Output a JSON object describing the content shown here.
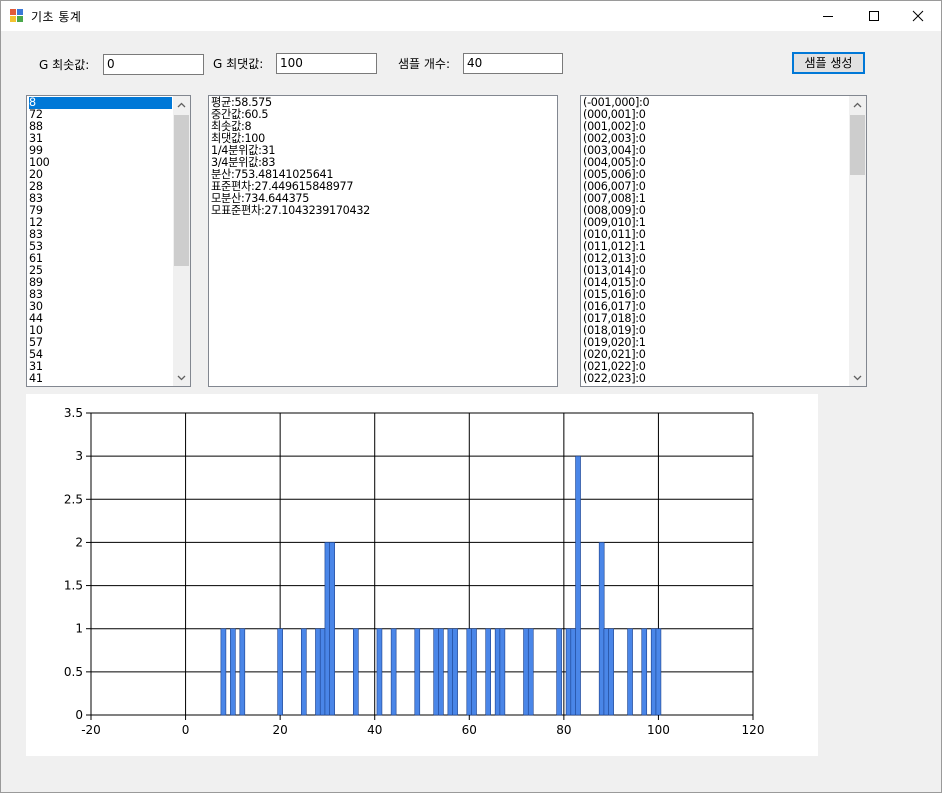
{
  "window": {
    "title": "기초 통계"
  },
  "controls": {
    "min_label": "G 최솟값:",
    "min_value": "0",
    "max_label": "G 최댓값:",
    "max_value": "100",
    "count_label": "샘플 개수:",
    "count_value": "40",
    "generate_label": "샘플 생성"
  },
  "samples": [
    "8",
    "72",
    "88",
    "31",
    "99",
    "100",
    "20",
    "28",
    "83",
    "79",
    "12",
    "83",
    "53",
    "61",
    "25",
    "89",
    "83",
    "30",
    "44",
    "10",
    "57",
    "54",
    "31",
    "41"
  ],
  "stats": [
    "평균:58.575",
    "중간값:60.5",
    "최솟값:8",
    "최댓값:100",
    "1/4분위값:31",
    "3/4분위값:83",
    "분산:753.48141025641",
    "표준편차:27.449615848977",
    "모분산:734.644375",
    "모표준편차:27.1043239170432"
  ],
  "bins": [
    "(-001,000]:0",
    "(000,001]:0",
    "(001,002]:0",
    "(002,003]:0",
    "(003,004]:0",
    "(004,005]:0",
    "(005,006]:0",
    "(006,007]:0",
    "(007,008]:1",
    "(008,009]:0",
    "(009,010]:1",
    "(010,011]:0",
    "(011,012]:1",
    "(012,013]:0",
    "(013,014]:0",
    "(014,015]:0",
    "(015,016]:0",
    "(016,017]:0",
    "(017,018]:0",
    "(018,019]:0",
    "(019,020]:1",
    "(020,021]:0",
    "(021,022]:0",
    "(022,023]:0"
  ],
  "chart_data": {
    "type": "bar",
    "xlim": [
      -20,
      120
    ],
    "ylim": [
      0,
      3.5
    ],
    "xticks": [
      -20,
      0,
      20,
      40,
      60,
      80,
      100,
      120
    ],
    "yticks": [
      0,
      0.5,
      1,
      1.5,
      2,
      2.5,
      3,
      3.5
    ],
    "x": [
      8,
      10,
      12,
      20,
      25,
      28,
      29,
      30,
      31,
      36,
      41,
      44,
      49,
      53,
      54,
      56,
      57,
      60,
      61,
      64,
      66,
      67,
      72,
      73,
      79,
      81,
      82,
      83,
      88,
      89,
      90,
      94,
      97,
      99,
      100
    ],
    "values": [
      1,
      1,
      1,
      1,
      1,
      1,
      1,
      2,
      2,
      1,
      1,
      1,
      1,
      1,
      1,
      1,
      1,
      1,
      1,
      1,
      1,
      1,
      1,
      1,
      1,
      1,
      1,
      3,
      2,
      1,
      1,
      1,
      1,
      1,
      1
    ],
    "bar_color": "#4a86e8",
    "grid": true
  }
}
